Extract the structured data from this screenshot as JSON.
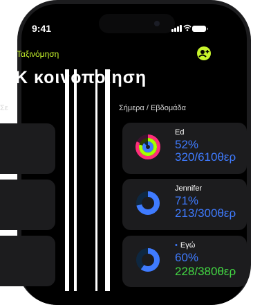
{
  "status": {
    "time": "9:41"
  },
  "nav": {
    "sort_label": "Ταξινόμηση"
  },
  "header": {
    "title": "Κ          κοινοποίηση",
    "date_left": "Σε",
    "date_right": "Σήμερα / Εβδομάδα"
  },
  "friends": [
    {
      "name": "Ed",
      "percent": "52%",
      "amount": "320/610θερ",
      "ring": "multi"
    },
    {
      "name": "Jennifer",
      "percent": "71%",
      "amount": "213/300θερ",
      "ring": "blue"
    },
    {
      "name": "Εγώ",
      "percent": "60%",
      "amount": "228/380θερ",
      "ring": "blue"
    }
  ],
  "colors": {
    "accent": "#c8f52c",
    "move": "#ff2d7a",
    "exercise": "#a6ff00",
    "stand": "#3f7bff"
  }
}
